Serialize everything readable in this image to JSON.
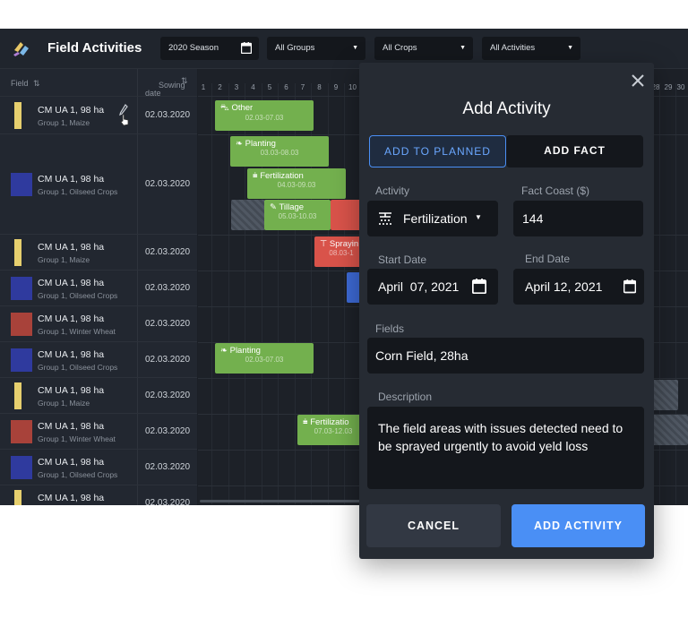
{
  "app": {
    "title": "Field Activities",
    "filters": {
      "season": "2020 Season",
      "groups": "All Groups",
      "crops": "All Crops",
      "activities": "All Activities"
    }
  },
  "table": {
    "headers": {
      "field": "Field",
      "sowing": "Sowing\ndate"
    },
    "rows": [
      {
        "name": "CM UA 1, 98 ha",
        "group": "Group 1, Maize",
        "date": "02.03.2020",
        "color": "#e6cf6e"
      },
      {
        "name": "CM UA 1, 98 ha",
        "group": "Group 1, Oilseed Crops",
        "date": "02.03.2020",
        "color": "#2f3a9e"
      },
      {
        "name": "CM UA 1, 98 ha",
        "group": "Group 1, Maize",
        "date": "02.03.2020",
        "color": "#e6cf6e"
      },
      {
        "name": "CM UA 1, 98 ha",
        "group": "Group 1, Oilseed Crops",
        "date": "02.03.2020",
        "color": "#2f3a9e"
      },
      {
        "name": "CM UA 1, 98 ha",
        "group": "Group 1, Winter Wheat",
        "date": "02.03.2020",
        "color": "#a8423a"
      },
      {
        "name": "CM UA 1, 98 ha",
        "group": "Group 1, Oilseed Crops",
        "date": "02.03.2020",
        "color": "#2f3a9e"
      },
      {
        "name": "CM UA 1, 98 ha",
        "group": "Group 1, Maize",
        "date": "02.03.2020",
        "color": "#e6cf6e"
      },
      {
        "name": "CM UA 1, 98 ha",
        "group": "Group 1, Winter Wheat",
        "date": "02.03.2020",
        "color": "#a8423a"
      },
      {
        "name": "CM UA 1, 98 ha",
        "group": "Group 1, Oilseed Crops",
        "date": "02.03.2020",
        "color": "#2f3a9e"
      },
      {
        "name": "CM UA 1, 98 ha",
        "group": "",
        "date": "02.03.2020",
        "color": "#e6cf6e"
      }
    ]
  },
  "gantt": {
    "days_left": [
      "1",
      "2",
      "3",
      "4",
      "5",
      "6",
      "7",
      "8",
      "9",
      "10"
    ],
    "days_right": [
      "28",
      "29",
      "30"
    ],
    "bars": {
      "other": {
        "label": "Other",
        "dates": "02.03-07.03"
      },
      "planting1": {
        "label": "Planting",
        "dates": "03.03-08.03"
      },
      "fertilization1": {
        "label": "Fertilization",
        "dates": "04.03-09.03"
      },
      "tillage": {
        "label": "Tillage",
        "dates": "05.03-10.03"
      },
      "spraying": {
        "label": "Sprayin",
        "dates": "08.03-1"
      },
      "planting2": {
        "label": "Planting",
        "dates": "02.03-07.03"
      },
      "fertilization2": {
        "label": "Fertilizatio",
        "dates": "07.03-12.03"
      }
    }
  },
  "modal": {
    "title": "Add Activity",
    "tabs": {
      "planned": "ADD TO PLANNED",
      "fact": "ADD FACT"
    },
    "activity_label": "Activity",
    "activity_value": "Fertilization",
    "cost_label": "Fact Coast ($)",
    "cost_value": "144",
    "start_label": "Start Date",
    "start_value": "April  07, 2021",
    "end_label": "End Date",
    "end_value": "April 12, 2021",
    "fields_label": "Fields",
    "fields_value": "Corn Field, 28ha",
    "description_label": "Description",
    "description_value": "The field areas with issues detected need to be sprayed urgently to avoid yeld loss",
    "cancel": "CANCEL",
    "submit": "ADD ACTIVITY"
  },
  "colors": {
    "accent": "#4a8ff5",
    "green": "#73b04e",
    "red": "#d9534a"
  }
}
